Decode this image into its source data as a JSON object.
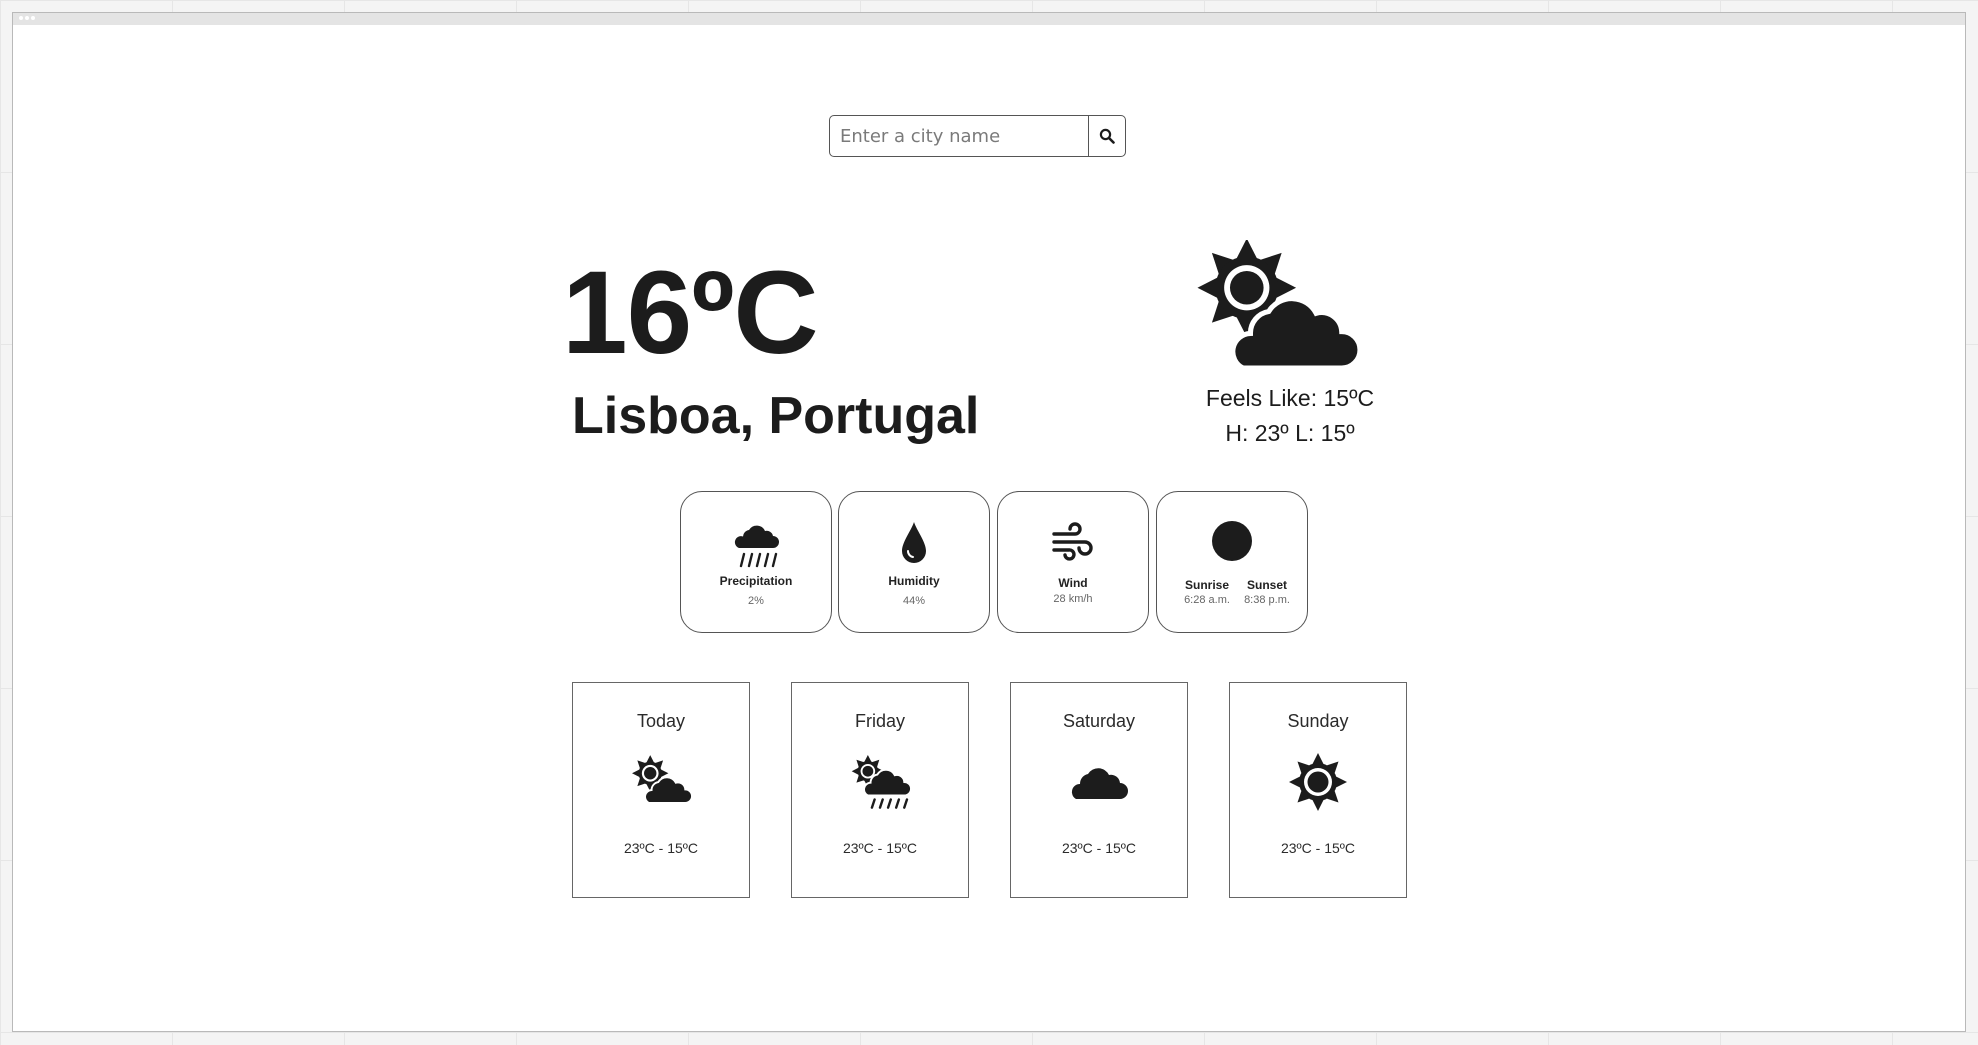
{
  "search": {
    "placeholder": "Enter a city name",
    "icon": "search-icon"
  },
  "current": {
    "temperature": "16ºC",
    "location": "Lisboa, Portugal",
    "icon": "partly-cloudy-icon",
    "feels_like": "Feels Like: 15ºC",
    "high_low": "H: 23º L: 15º"
  },
  "details": {
    "precipitation": {
      "label": "Precipitation",
      "value": "2%",
      "icon": "rain-cloud-icon"
    },
    "humidity": {
      "label": "Humidity",
      "value": "44%",
      "icon": "water-drop-icon"
    },
    "wind": {
      "label": "Wind",
      "value": "28 km/h",
      "icon": "wind-icon"
    },
    "sun": {
      "icon": "sun-circle-icon",
      "sunrise_label": "Sunrise",
      "sunrise_value": "6:28 a.m.",
      "sunset_label": "Sunset",
      "sunset_value": "8:38 p.m."
    }
  },
  "forecast": [
    {
      "day": "Today",
      "icon": "partly-cloudy-icon",
      "range": "23ºC - 15ºC"
    },
    {
      "day": "Friday",
      "icon": "sun-cloud-rain-icon",
      "range": "23ºC - 15ºC"
    },
    {
      "day": "Saturday",
      "icon": "cloud-icon",
      "range": "23ºC - 15ºC"
    },
    {
      "day": "Sunday",
      "icon": "sun-icon",
      "range": "23ºC - 15ºC"
    }
  ],
  "colors": {
    "text": "#1c1c1c",
    "border": "#555555",
    "muted": "#666666",
    "background": "#ffffff"
  }
}
